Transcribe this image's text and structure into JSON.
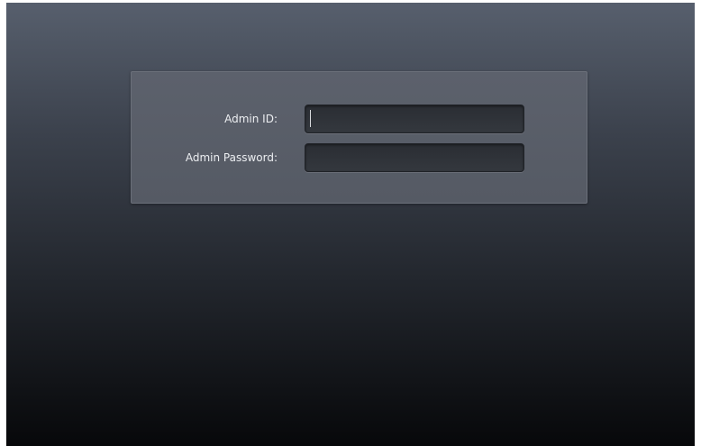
{
  "login": {
    "admin_id": {
      "label": "Admin ID:",
      "value": ""
    },
    "admin_password": {
      "label": "Admin Password:",
      "value": ""
    }
  },
  "colors": {
    "background_top": "#575f6d",
    "background_bottom": "#07080a",
    "panel": "#5a5f69",
    "input": "#2c2f35",
    "label_text": "#eceef1"
  }
}
